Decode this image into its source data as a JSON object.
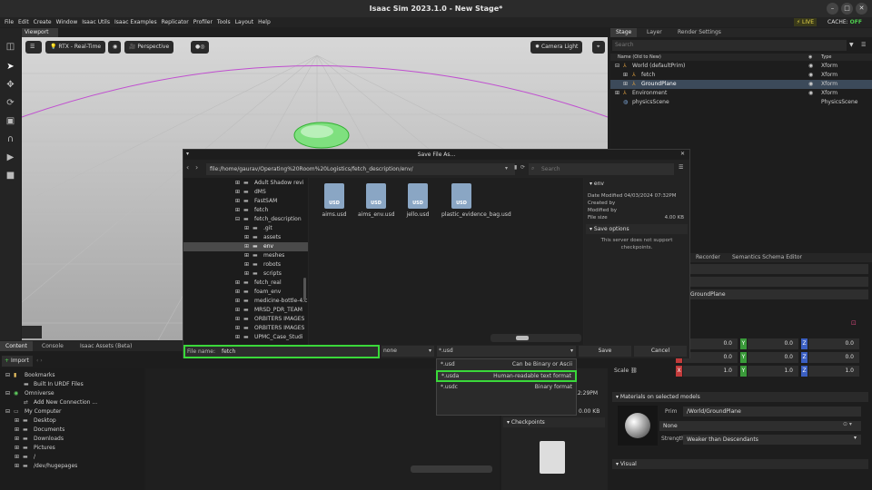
{
  "app": {
    "title": "Isaac Sim 2023.1.0 - New Stage*"
  },
  "menu": [
    "File",
    "Edit",
    "Create",
    "Window",
    "Isaac Utils",
    "Isaac Examples",
    "Replicator",
    "Profiler",
    "Tools",
    "Layout",
    "Help"
  ],
  "status": {
    "live": "LIVE",
    "cache_label": "CACHE:",
    "cache_value": "OFF"
  },
  "viewport": {
    "tab": "Viewport",
    "render_mode": "RTX - Real-Time",
    "camera": "Perspective",
    "camera_light": "Camera Light"
  },
  "stage": {
    "tabs": [
      "Stage",
      "Layer",
      "Render Settings"
    ],
    "search_placeholder": "Search",
    "col_name": "Name (Old to New)",
    "col_type": "Type",
    "rows": [
      {
        "name": "World (defaultPrim)",
        "type": "Xform"
      },
      {
        "name": "fetch",
        "type": "Xform"
      },
      {
        "name": "GroundPlane",
        "type": "Xform"
      },
      {
        "name": "Environment",
        "type": "Xform"
      },
      {
        "name": "physicsScene",
        "type": "PhysicsScene"
      }
    ]
  },
  "dialog": {
    "title": "Save File As...",
    "path": "file:/home/gaurav/Operating%20Room%20Logistics/fetch_description/env/",
    "search_placeholder": "Search",
    "tree": [
      "Adult Shadow revi",
      "dMS",
      "FastSAM",
      "fetch",
      "fetch_description",
      ".git",
      "assets",
      "env",
      "meshes",
      "robots",
      "scripts",
      "fetch_real",
      "foam_env",
      "medicine-bottle-4.c",
      "MRSD_PDR_TEAM",
      "ORBITERS IMAGES",
      "ORBITERS IMAGES",
      "UPMC_Case_Studi"
    ],
    "files": [
      "aims.usd",
      "aims_env.usd",
      "jello.usd",
      "plastic_evidence_bag.usd"
    ],
    "info": {
      "folder": "env",
      "date_modified_label": "Date Modified",
      "date_modified": "04/03/2024 07:32PM",
      "created_by": "Created by",
      "modified_by": "Modified by",
      "file_size_label": "File size",
      "file_size": "4.00 KB",
      "save_options": "Save options",
      "save_options_msg": "This server does not support checkpoints."
    },
    "file_name_label": "File name:",
    "file_name": "fetch",
    "ext_filter": "none",
    "ext_selected": "*.usd",
    "save": "Save",
    "cancel": "Cancel"
  },
  "dropdown": [
    {
      "ext": "*.usd",
      "desc": "Can be Binary or Ascii"
    },
    {
      "ext": "*.usda",
      "desc": "Human-readable text format"
    },
    {
      "ext": "*.usdc",
      "desc": "Binary format"
    }
  ],
  "content": {
    "tabs": [
      "Content",
      "Console",
      "Isaac Assets (Beta)"
    ],
    "import": "Import",
    "tree": [
      "Bookmarks",
      "Built In URDF Files",
      "Omniverse",
      "Add New Connection ...",
      "My Computer",
      "Desktop",
      "Documents",
      "Downloads",
      "Pictures",
      "/",
      "/dev/hugepages"
    ],
    "time": "12:29PM",
    "size": "0.00 KB",
    "checkpoints": "Checkpoints"
  },
  "properties": {
    "tabs": [
      "Recorder",
      "Semantics Schema Editor"
    ],
    "prim_name": "GroundPlane",
    "scale_label": "Scale",
    "rows": [
      {
        "x": "0.0",
        "y": "0.0",
        "z": "0.0"
      },
      {
        "x": "0.0",
        "y": "0.0",
        "z": "0.0"
      },
      {
        "x": "1.0",
        "y": "1.0",
        "z": "1.0"
      }
    ],
    "materials_header": "Materials on selected models",
    "prim_label": "Prim",
    "prim_path": "/World/GroundPlane",
    "material": "None",
    "strength_label": "Strength",
    "strength": "Weaker than Descendants",
    "visual": "Visual"
  },
  "colors": {
    "accent": "#3ad83a",
    "x_axis": "#c23b3b",
    "y_axis": "#3a9a3a",
    "z_axis": "#3b5fc2"
  }
}
